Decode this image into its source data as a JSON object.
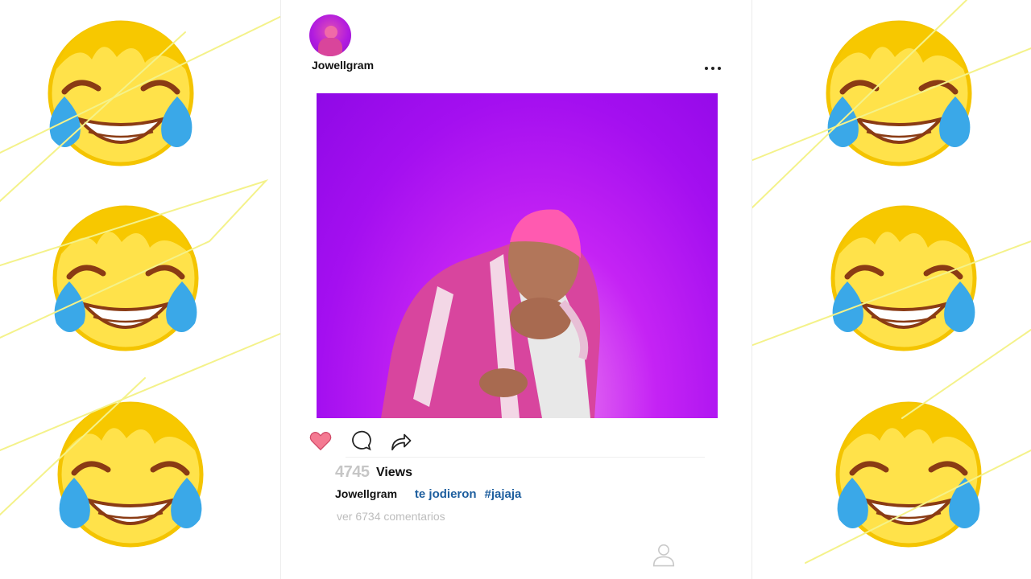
{
  "post": {
    "username": "Jowellgram",
    "more_icon": "more-options-icon",
    "views_count": "4745",
    "views_label": "Views",
    "caption_user": "Jowellgram",
    "caption_text": "te jodieron",
    "caption_hashtag": "#jajaja",
    "comments_link": "ver 6734 comentarios",
    "actions": [
      "heart-icon",
      "comment-icon",
      "share-icon"
    ],
    "profile_icon": "user-icon"
  },
  "decoration": {
    "emoji": "face-with-tears-of-joy",
    "emoji_count_per_side": 3
  },
  "colors": {
    "heart": "#f47a92",
    "link": "#1d5e9e",
    "muted": "#bdbdbd",
    "media_purple": "#a40ff0",
    "scribble": "#f4f28a"
  }
}
